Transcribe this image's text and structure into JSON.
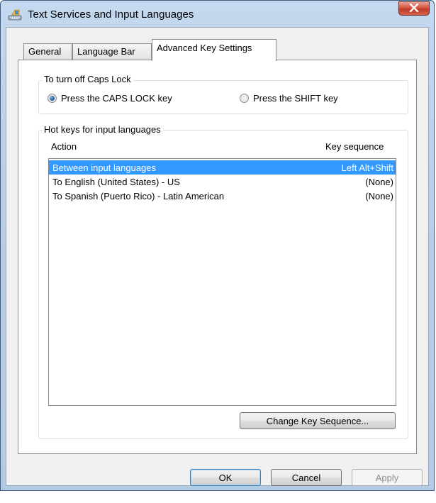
{
  "window": {
    "title": "Text Services and Input Languages",
    "close_glyph": "x"
  },
  "tabs": [
    {
      "label": "General"
    },
    {
      "label": "Language Bar"
    },
    {
      "label": "Advanced Key Settings",
      "active": true
    }
  ],
  "caps_lock": {
    "group_label": "To turn off Caps Lock",
    "option_caps": "Press the CAPS LOCK key",
    "option_shift": "Press the SHIFT key",
    "selected": "caps"
  },
  "hotkeys": {
    "group_label": "Hot keys for input languages",
    "col_action": "Action",
    "col_sequence": "Key sequence",
    "rows": [
      {
        "action": "Between input languages",
        "sequence": "Left Alt+Shift",
        "selected": true
      },
      {
        "action": "To English (United States) - US",
        "sequence": "(None)",
        "selected": false
      },
      {
        "action": "To Spanish (Puerto Rico) - Latin American",
        "sequence": "(None)",
        "selected": false
      }
    ],
    "change_button": "Change Key Sequence..."
  },
  "footer": {
    "ok": "OK",
    "cancel": "Cancel",
    "apply": "Apply"
  },
  "colors": {
    "selection": "#3399ff",
    "close_button": "#c03a25",
    "title_bar": "#b9cfe9"
  }
}
